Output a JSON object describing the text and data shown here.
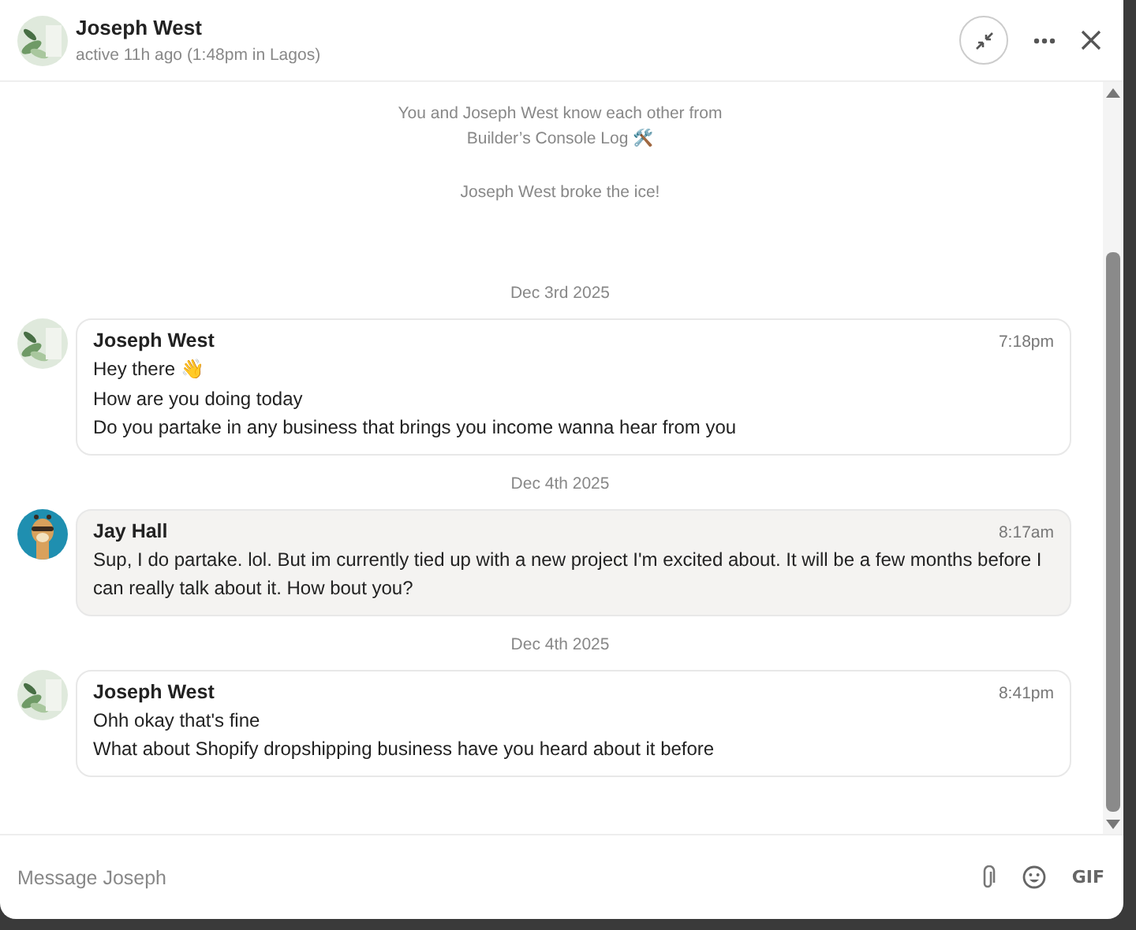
{
  "header": {
    "name": "Joseph West",
    "status": "active 11h ago (1:48pm in Lagos)"
  },
  "intro": {
    "lines": [
      "You and Joseph West know each other from",
      "Builder’s Console Log 🛠️"
    ],
    "ice": "Joseph West broke the ice!"
  },
  "messages": [
    {
      "date": "Dec 3rd 2025",
      "sender": "Joseph West",
      "time": "7:18pm",
      "own": false,
      "lines": [
        "Hey there 👋",
        "How are you doing today",
        "Do you partake in any business that brings you income wanna hear from you"
      ]
    },
    {
      "date": "Dec 4th 2025",
      "sender": "Jay Hall",
      "time": "8:17am",
      "own": true,
      "lines": [
        "Sup, I do partake. lol. But im currently tied up with a new project I'm excited about. It will be a few months before I can really talk about it. How bout you?"
      ]
    },
    {
      "date": "Dec 4th 2025",
      "sender": "Joseph West",
      "time": "8:41pm",
      "own": false,
      "lines": [
        "Ohh okay that's fine",
        "What about Shopify dropshipping business have you heard about it before"
      ]
    }
  ],
  "composer": {
    "placeholder": "Message Joseph",
    "gif": "GIF"
  }
}
